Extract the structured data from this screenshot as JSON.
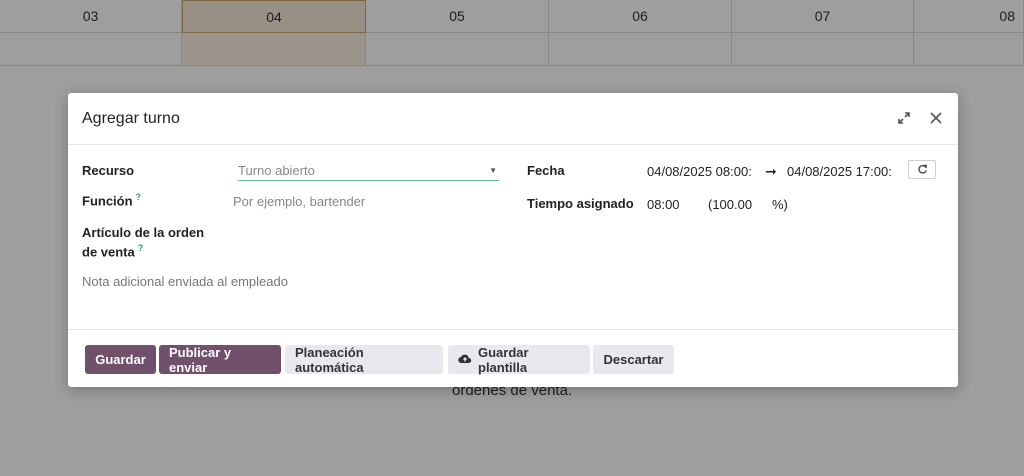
{
  "calendar": {
    "days": [
      "03",
      "04",
      "05",
      "06",
      "07",
      "08"
    ],
    "background_text": "órdenes de venta."
  },
  "modal": {
    "title": "Agregar turno",
    "labels": {
      "recurso": "Recurso",
      "funcion": "Función",
      "articulo_line1": "Artículo de la orden",
      "articulo_line2": "de venta",
      "fecha": "Fecha",
      "tiempo": "Tiempo asignado",
      "help": "?"
    },
    "fields": {
      "recurso_value": "Turno abierto",
      "funcion_placeholder": "Por ejemplo, bartender",
      "note_placeholder": "Nota adicional enviada al empleado",
      "fecha_start": "04/08/2025 08:00:",
      "fecha_end": "04/08/2025 17:00:",
      "arrow": "➞",
      "hours": "08:00",
      "percent": "(100.00",
      "percent_sign": "%)"
    },
    "buttons": {
      "save": "Guardar",
      "publish": "Publicar y enviar",
      "auto_plan": "Planeación automática",
      "save_template": "Guardar plantilla",
      "discard": "Descartar"
    }
  },
  "colors": {
    "primary": "#71506b",
    "secondary": "#e7e9ed",
    "accent": "#3a8ea2"
  }
}
